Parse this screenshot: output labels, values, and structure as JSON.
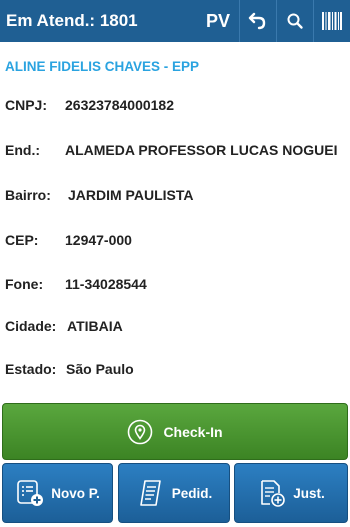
{
  "header": {
    "title": "Em Atend.: 1801",
    "mode_label": "PV",
    "icons": [
      "undo-icon",
      "search-icon",
      "barcode-icon"
    ]
  },
  "client": {
    "name": "ALINE FIDELIS CHAVES - EPP",
    "fields": [
      {
        "label": "CNPJ:",
        "value": "26323784000182"
      },
      {
        "label": "End.:",
        "value": "ALAMEDA PROFESSOR LUCAS NOGUEI"
      },
      {
        "label": "Bairro:",
        "value": "JARDIM PAULISTA"
      },
      {
        "label": "CEP:",
        "value": "12947-000"
      },
      {
        "label": "Fone:",
        "value": "11-34028544"
      },
      {
        "label": "Cidade:",
        "value": "ATIBAIA"
      },
      {
        "label": "Estado:",
        "value": "São Paulo"
      }
    ]
  },
  "actions": {
    "checkin_label": "Check-In",
    "new_order_label": "Novo P.",
    "orders_label": "Pedid.",
    "justify_label": "Just."
  },
  "colors": {
    "header_bg": "#1f5f93",
    "company_name": "#2aa3e0",
    "checkin_bg": "#4a9a30",
    "action_bg": "#2470b0"
  }
}
